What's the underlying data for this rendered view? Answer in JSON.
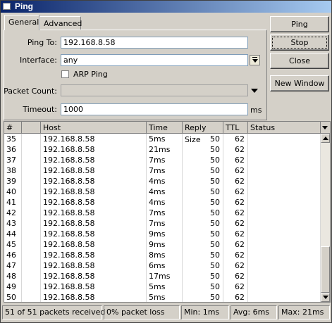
{
  "window": {
    "title": "Ping"
  },
  "tabs": [
    {
      "label": "General"
    },
    {
      "label": "Advanced"
    }
  ],
  "form": {
    "ping_to_label": "Ping To:",
    "ping_to_value": "192.168.8.58",
    "interface_label": "Interface:",
    "interface_value": "any",
    "arp_ping_label": "ARP Ping",
    "arp_ping_checked": false,
    "packet_count_label": "Packet Count:",
    "packet_count_value": "",
    "timeout_label": "Timeout:",
    "timeout_value": "1000",
    "timeout_unit": "ms"
  },
  "buttons": {
    "ping": "Ping",
    "stop": "Stop",
    "close": "Close",
    "new_window": "New Window"
  },
  "table": {
    "columns": [
      "#",
      "Host",
      "Time",
      "Reply Size",
      "TTL",
      "Status"
    ],
    "rows": [
      {
        "num": "35",
        "host": "192.168.8.58",
        "time": "5ms",
        "size": "50",
        "ttl": "62",
        "status": ""
      },
      {
        "num": "36",
        "host": "192.168.8.58",
        "time": "21ms",
        "size": "50",
        "ttl": "62",
        "status": ""
      },
      {
        "num": "37",
        "host": "192.168.8.58",
        "time": "7ms",
        "size": "50",
        "ttl": "62",
        "status": ""
      },
      {
        "num": "38",
        "host": "192.168.8.58",
        "time": "7ms",
        "size": "50",
        "ttl": "62",
        "status": ""
      },
      {
        "num": "39",
        "host": "192.168.8.58",
        "time": "4ms",
        "size": "50",
        "ttl": "62",
        "status": ""
      },
      {
        "num": "40",
        "host": "192.168.8.58",
        "time": "4ms",
        "size": "50",
        "ttl": "62",
        "status": ""
      },
      {
        "num": "41",
        "host": "192.168.8.58",
        "time": "4ms",
        "size": "50",
        "ttl": "62",
        "status": ""
      },
      {
        "num": "42",
        "host": "192.168.8.58",
        "time": "7ms",
        "size": "50",
        "ttl": "62",
        "status": ""
      },
      {
        "num": "43",
        "host": "192.168.8.58",
        "time": "7ms",
        "size": "50",
        "ttl": "62",
        "status": ""
      },
      {
        "num": "44",
        "host": "192.168.8.58",
        "time": "9ms",
        "size": "50",
        "ttl": "62",
        "status": ""
      },
      {
        "num": "45",
        "host": "192.168.8.58",
        "time": "9ms",
        "size": "50",
        "ttl": "62",
        "status": ""
      },
      {
        "num": "46",
        "host": "192.168.8.58",
        "time": "8ms",
        "size": "50",
        "ttl": "62",
        "status": ""
      },
      {
        "num": "47",
        "host": "192.168.8.58",
        "time": "6ms",
        "size": "50",
        "ttl": "62",
        "status": ""
      },
      {
        "num": "48",
        "host": "192.168.8.58",
        "time": "17ms",
        "size": "50",
        "ttl": "62",
        "status": ""
      },
      {
        "num": "49",
        "host": "192.168.8.58",
        "time": "5ms",
        "size": "50",
        "ttl": "62",
        "status": ""
      },
      {
        "num": "50",
        "host": "192.168.8.58",
        "time": "5ms",
        "size": "50",
        "ttl": "62",
        "status": ""
      }
    ],
    "scroll_position_fraction": 1.0,
    "visible_fraction": 0.31
  },
  "status": {
    "received": "51 of 51 packets received",
    "loss": "0% packet loss",
    "min": "Min: 1ms",
    "avg": "Avg: 6ms",
    "max": "Max: 21ms"
  },
  "colors": {
    "title_bar": "#0a246a",
    "window_bg": "#d4d0c8"
  },
  "icons": {
    "window": "window-icon",
    "dropdown": "dropdown-arrow-icon",
    "column_menu": "column-menu-icon"
  }
}
